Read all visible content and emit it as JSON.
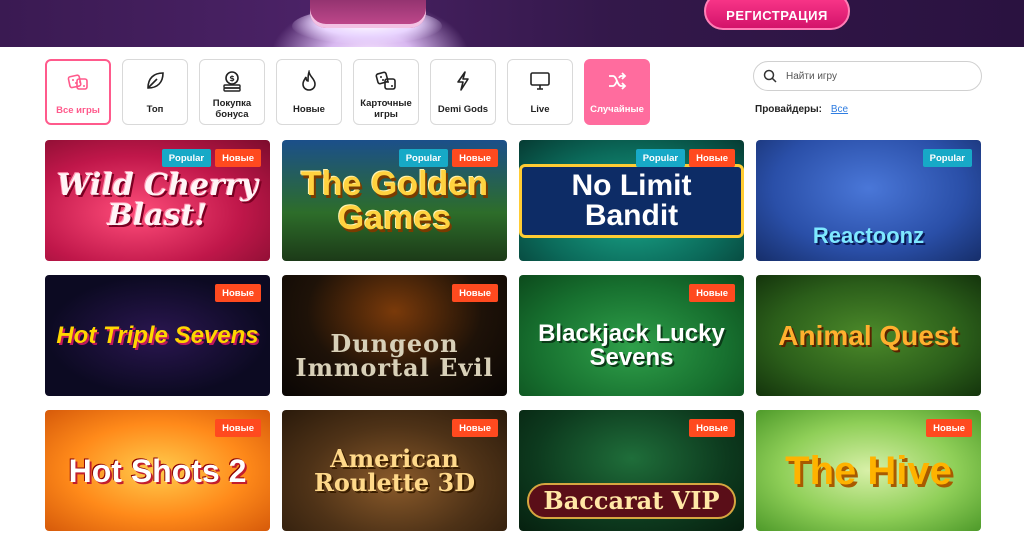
{
  "header": {
    "register_label": "РЕГИСТРАЦИЯ"
  },
  "filters": [
    {
      "label": "Все игры",
      "icon": "dice-icon",
      "active": true
    },
    {
      "label": "Топ",
      "icon": "leaf-icon"
    },
    {
      "label": "Покупка бонуса",
      "icon": "coin-stack-icon"
    },
    {
      "label": "Новые",
      "icon": "flame-icon"
    },
    {
      "label": "Карточные игры",
      "icon": "dice-icon"
    },
    {
      "label": "Demi Gods",
      "icon": "lightning-icon"
    },
    {
      "label": "Live",
      "icon": "monitor-icon"
    },
    {
      "label": "Случайные",
      "icon": "shuffle-icon"
    }
  ],
  "search": {
    "placeholder": "Найти игру"
  },
  "providers": {
    "label": "Провайдеры:",
    "value": "Все"
  },
  "badges": {
    "popular": "Popular",
    "new": "Новые"
  },
  "games": [
    {
      "title": "Wild Cherry Blast!",
      "popular": true,
      "new": true
    },
    {
      "title": "The Golden Games",
      "popular": true,
      "new": true
    },
    {
      "title": "No Limit Bandit",
      "popular": true,
      "new": true
    },
    {
      "title": "Reactoonz",
      "popular": true,
      "new": false
    },
    {
      "title": "Hot Triple Sevens",
      "popular": false,
      "new": true
    },
    {
      "title": "Dungeon Immortal Evil",
      "popular": false,
      "new": true
    },
    {
      "title": "Blackjack Lucky Sevens",
      "popular": false,
      "new": true
    },
    {
      "title": "Animal Quest",
      "popular": false,
      "new": false
    },
    {
      "title": "Hot Shots 2",
      "popular": false,
      "new": true
    },
    {
      "title": "American Roulette 3D",
      "popular": false,
      "new": true
    },
    {
      "title": "Baccarat VIP",
      "popular": false,
      "new": true
    },
    {
      "title": "The Hive",
      "popular": false,
      "new": true
    }
  ],
  "colors": {
    "accent": "#ff5a8c",
    "register": "#e0186f",
    "popular_badge": "#17a9c7",
    "new_badge": "#ff4a1f",
    "link": "#2f7de1"
  }
}
